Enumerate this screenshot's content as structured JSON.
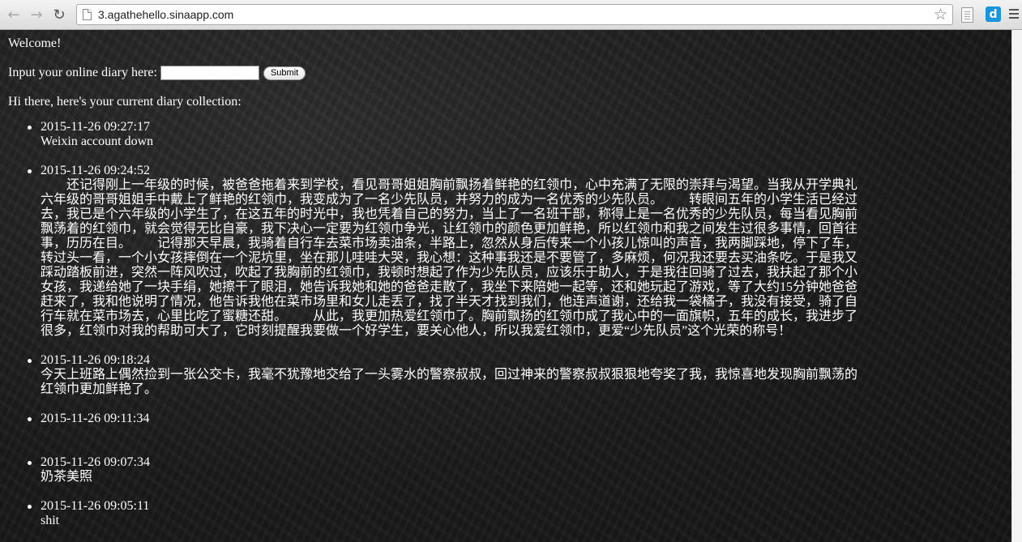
{
  "browser": {
    "url": "3.agathehello.sinaapp.com",
    "back_glyph": "←",
    "forward_glyph": "→",
    "reload_glyph": "↻",
    "star_glyph": "☆",
    "extension_label": "d"
  },
  "page": {
    "welcome": "Welcome!",
    "input_label": "Input your online diary here:",
    "input_value": "",
    "submit_label": "Submit",
    "intro": "Hi there, here's your current diary collection:"
  },
  "entries": [
    {
      "time": "2015-11-26 09:27:17",
      "text": "Weixin account down"
    },
    {
      "time": "2015-11-26 09:24:52",
      "text": "        还记得刚上一年级的时候，被爸爸拖着来到学校，看见哥哥姐姐胸前飘扬着鲜艳的红领巾，心中充满了无限的崇拜与渴望。当我从开学典礼六年级的哥哥姐姐手中戴上了鲜艳的红领巾，我变成为了一名少先队员，并努力的成为一名优秀的少先队员。        转眼间五年的小学生活已经过去，我已是个六年级的小学生了，在这五年的时光中，我也凭着自己的努力，当上了一名班干部，称得上是一名优秀的少先队员，每当看见胸前飘荡着的红领巾，就会觉得无比自豪，我下决心一定要为红领巾争光，让红领巾的颜色更加鲜艳，所以红领巾和我之间发生过很多事情，回首往事，历历在目。        记得那天早晨，我骑着自行车去菜市场卖油条，半路上，忽然从身后传来一个小孩儿惊叫的声音，我两脚踩地，停下了车，转过头一看，一个小女孩摔倒在一个泥坑里，坐在那儿哇哇大哭，我心想：这种事我还是不要管了，多麻烦，何况我还要去买油条吃。于是我又踩动踏板前进，突然一阵风吹过，吹起了我胸前的红领巾，我顿时想起了作为少先队员，应该乐于助人，于是我往回骑了过去，我扶起了那个小女孩，我递给她了一块手绢，她擦干了眼泪，她告诉我她和她的爸爸走散了，我坐下来陪她一起等，还和她玩起了游戏，等了大约15分钟她爸爸赶来了，我和他说明了情况，他告诉我他在菜市场里和女儿走丢了，找了半天才找到我们，他连声道谢，还给我一袋橘子，我没有接受，骑了自行车就在菜市场去，心里比吃了蜜糖还甜。        从此，我更加热爱红领巾了。胸前飘扬的红领巾成了我心中的一面旗帜，五年的成长，我进步了很多，红领巾对我的帮助可大了，它时刻提醒我要做一个好学生，要关心他人，所以我爱红领巾，更爱“少先队员”这个光荣的称号！"
    },
    {
      "time": "2015-11-26 09:18:24",
      "text": "今天上班路上偶然捡到一张公交卡，我毫不犹豫地交给了一头雾水的警察叔叔，回过神来的警察叔叔狠狠地夸奖了我，我惊喜地发现胸前飘荡的红领巾更加鲜艳了。"
    },
    {
      "time": "2015-11-26 09:11:34",
      "text": ""
    },
    {
      "time": "2015-11-26 09:07:34",
      "text": "奶茶美照"
    },
    {
      "time": "2015-11-26 09:05:11",
      "text": "shit"
    }
  ]
}
